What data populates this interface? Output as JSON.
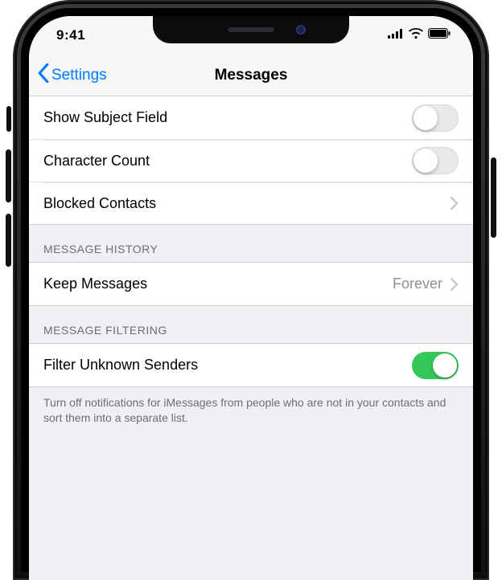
{
  "status": {
    "time": "9:41"
  },
  "nav": {
    "back": "Settings",
    "title": "Messages"
  },
  "groups": [
    {
      "header": null,
      "cells": [
        {
          "label": "Show Subject Field",
          "type": "toggle",
          "on": false
        },
        {
          "label": "Character Count",
          "type": "toggle",
          "on": false
        },
        {
          "label": "Blocked Contacts",
          "type": "link"
        }
      ],
      "footer": null
    },
    {
      "header": "MESSAGE HISTORY",
      "cells": [
        {
          "label": "Keep Messages",
          "type": "detail",
          "value": "Forever"
        }
      ],
      "footer": null
    },
    {
      "header": "MESSAGE FILTERING",
      "cells": [
        {
          "label": "Filter Unknown Senders",
          "type": "toggle",
          "on": true
        }
      ],
      "footer": "Turn off notifications for iMessages from people who are not in your contacts and sort them into a separate list."
    }
  ]
}
